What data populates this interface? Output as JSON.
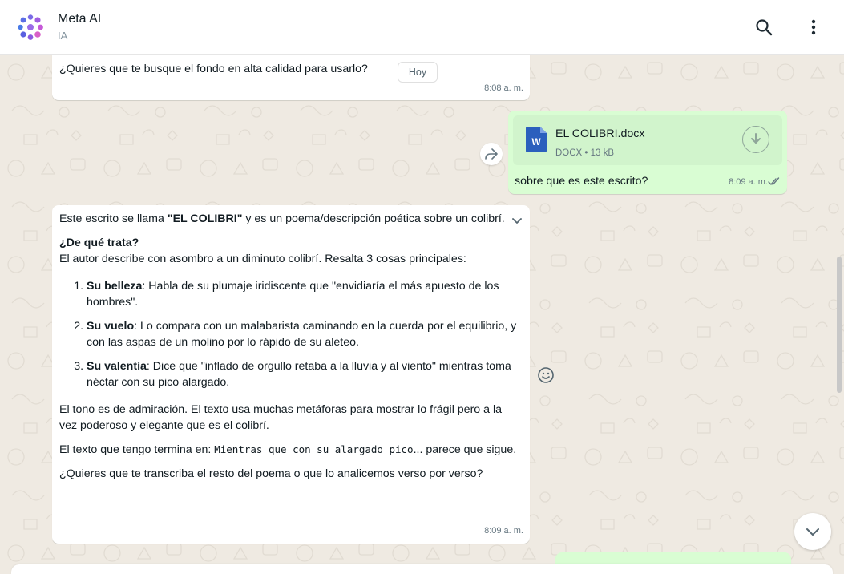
{
  "header": {
    "title": "Meta AI",
    "subtitle": "IA",
    "avatar_icon": "meta-ai-logo-icon",
    "search_icon": "search-icon",
    "menu_icon": "more-vertical-icon"
  },
  "messages": {
    "m1": {
      "text": "¿Quieres que te busque el fondo en alta calidad para usarlo?",
      "date_chip": "Hoy",
      "time": "8:08 a. m."
    },
    "m2": {
      "file_name": "EL COLIBRI.docx",
      "file_meta": "DOCX • 13 kB",
      "file_icon": "word-document-icon",
      "download_icon": "download-icon",
      "text": "sobre que es este escrito?",
      "time": "8:09 a. m.",
      "status_icon": "double-check-icon"
    },
    "m3": {
      "intro_pre": "Este escrito se llama ",
      "intro_bold": "\"EL COLIBRI\"",
      "intro_post": " y es un poema/descripción poética sobre un colibrí.",
      "heading": "¿De qué trata?",
      "summary": "El autor describe con asombro a un diminuto colibrí. Resalta 3 cosas principales:",
      "points": [
        {
          "label": "Su belleza",
          "text": ": Habla de su plumaje iridiscente que \"envidiaría el más apuesto de los hombres\"."
        },
        {
          "label": "Su vuelo",
          "text": ": Lo compara con un malabarista caminando en la cuerda por el equilibrio, y con las aspas de un molino por lo rápido de su aleteo."
        },
        {
          "label": "Su valentía",
          "text": ": Dice que \"inflado de orgullo retaba a la lluvia y al viento\" mientras toma néctar con su pico alargado."
        }
      ],
      "tone": "El tono es de admiración. El texto usa muchas metáforas para mostrar lo frágil pero a la vez poderoso y elegante que es el colibrí.",
      "ending_pre": "El texto que tengo termina en: ",
      "ending_code": "Mientras que con su alargado pico",
      "ending_post": "... parece que sigue.",
      "question": "¿Quieres que te transcriba el resto del poema o que lo analicemos verso por verso?",
      "time": "8:09 a. m."
    }
  },
  "colors": {
    "incoming_bubble": "#ffffff",
    "outgoing_bubble": "#d9fdd3",
    "chat_background": "#efeae2",
    "word_blue": "#2b5fbd"
  }
}
